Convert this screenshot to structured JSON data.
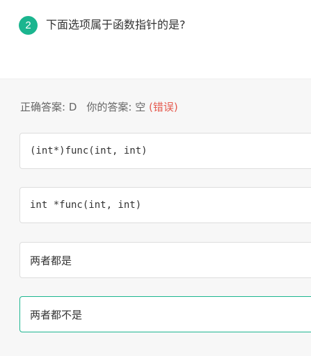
{
  "question": {
    "number": "2",
    "text": "下面选项属于函数指针的是?"
  },
  "result": {
    "correct_label": "正确答案: D",
    "your_label": "你的答案: 空",
    "status": "(错误)",
    "colors": {
      "accent": "#1bb58f",
      "wrong": "#e55a4e"
    }
  },
  "options": [
    {
      "text": "(int*)func(int, int)"
    },
    {
      "text": "int *func(int, int)"
    },
    {
      "text": "两者都是"
    },
    {
      "text": "两者都不是"
    }
  ]
}
